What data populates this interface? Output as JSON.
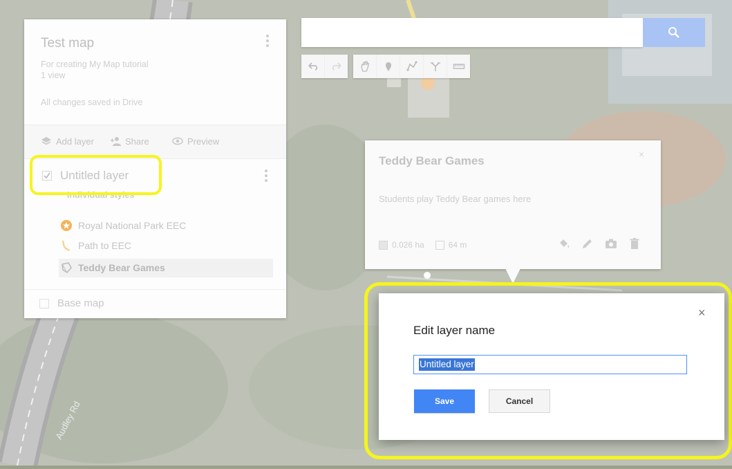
{
  "map": {
    "road_label": "Audley Rd"
  },
  "panel": {
    "title": "Test map",
    "description": "For creating My Map tutorial",
    "views": "1 view",
    "save_status": "All changes saved in Drive",
    "actions": {
      "add_layer": "Add layer",
      "share": "Share",
      "preview": "Preview"
    },
    "layer": {
      "name": "Untitled layer",
      "styles": "Individual styles",
      "features": [
        "Royal National Park EEC",
        "Path to EEC",
        "Teddy Bear Games"
      ]
    },
    "base_map": "Base map"
  },
  "search": {
    "placeholder": ""
  },
  "card": {
    "title": "Teddy Bear Games",
    "description": "Students play Teddy Bear games here",
    "area": "0.026 ha",
    "perimeter": "64 m"
  },
  "dialog": {
    "title": "Edit layer name",
    "input_value": "Untitled layer",
    "save_label": "Save",
    "cancel_label": "Cancel",
    "close_glyph": "×"
  },
  "colors": {
    "highlight": "#f5f51e",
    "primary": "#4285f4",
    "selection": "#3875d7"
  }
}
